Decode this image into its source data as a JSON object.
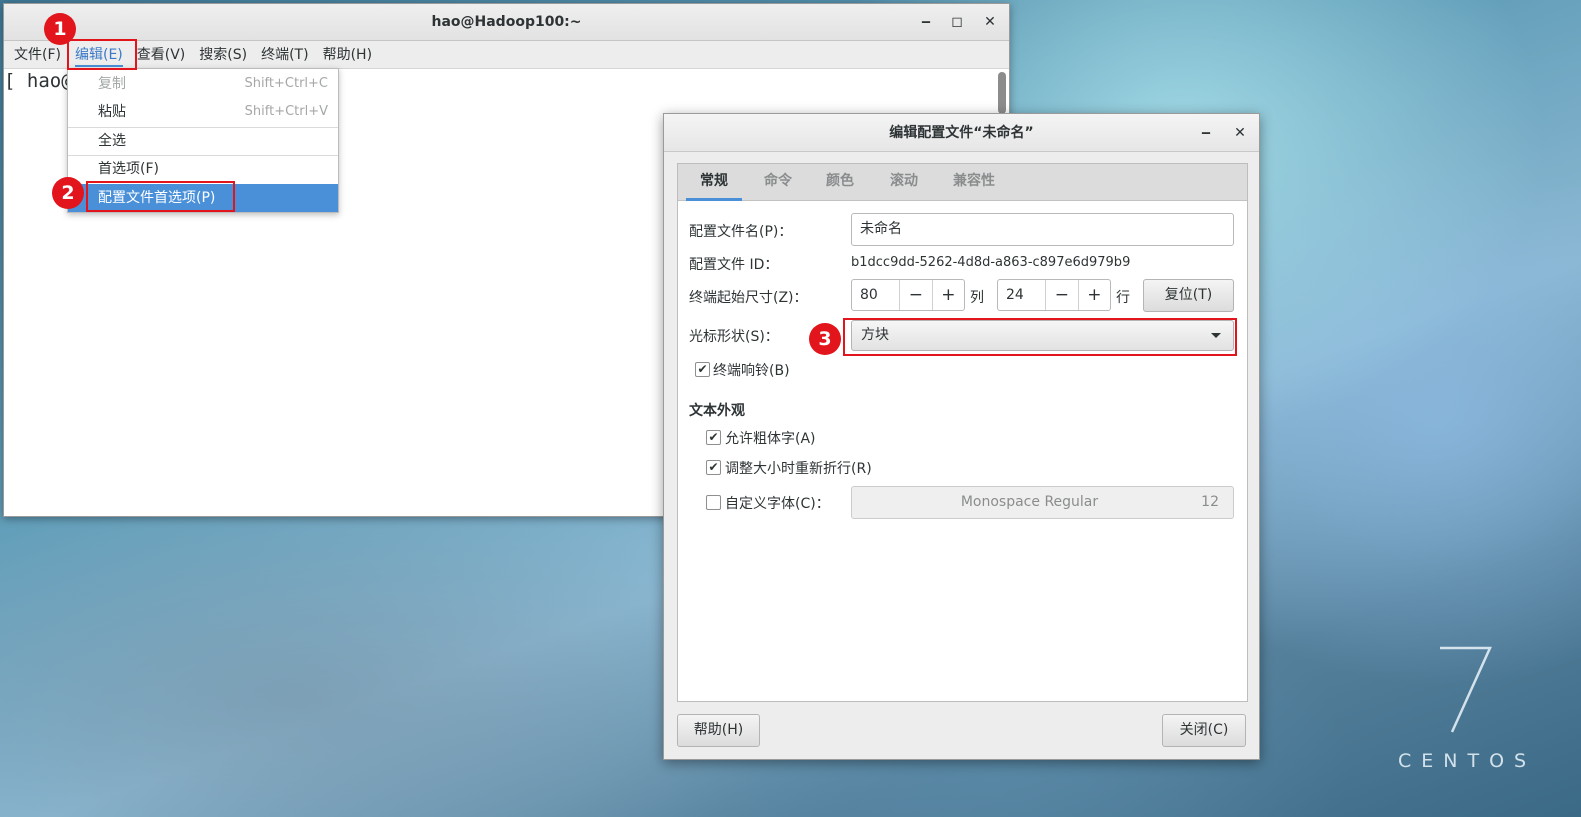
{
  "terminal": {
    "title": "hao@Hadoop100:~",
    "minimize": "‒",
    "maximize": "◻",
    "close": "✕",
    "menu": [
      "文件(F)",
      "编辑(E)",
      "查看(V)",
      "搜索(S)",
      "终端(T)",
      "帮助(H)"
    ],
    "prompt": "[ hao@"
  },
  "edit_menu": {
    "copy": "复制",
    "copy_accel": "Shift+Ctrl+C",
    "paste": "粘贴",
    "paste_accel": "Shift+Ctrl+V",
    "select_all": "全选",
    "preferences": "首选项(F)",
    "profile_prefs": "配置文件首选项(P)"
  },
  "callouts": [
    "1",
    "2",
    "3"
  ],
  "dialog": {
    "title": "编辑配置文件“未命名”",
    "minimize": "‒",
    "close": "✕",
    "tabs": [
      "常规",
      "命令",
      "颜色",
      "滚动",
      "兼容性"
    ],
    "profile_name_label": "配置文件名(P)：",
    "profile_name_value": "未命名",
    "profile_id_label": "配置文件 ID：",
    "profile_id_value": "b1dcc9dd-5262-4d8d-a863-c897e6d979b9",
    "size_label": "终端起始尺寸(Z)：",
    "columns_value": "80",
    "columns_unit": "列",
    "rows_value": "24",
    "rows_unit": "行",
    "spin_minus": "−",
    "spin_plus": "+",
    "reset_button": "复位(T)",
    "cursor_label": "光标形状(S)：",
    "cursor_value": "方块",
    "bell_label": "终端响铃(B)",
    "bell_checked": true,
    "text_section": "文本外观",
    "bold_label": "允许粗体字(A)",
    "bold_checked": true,
    "rewrap_label": "调整大小时重新折行(R)",
    "rewrap_checked": true,
    "custom_font_label": "自定义字体(C)：",
    "custom_font_checked": false,
    "font_name": "Monospace Regular",
    "font_size": "12",
    "help_button": "帮助(H)",
    "close_button": "关闭(C)"
  },
  "desktop": {
    "brand_digit": "7",
    "brand_word": "CENTOS"
  }
}
